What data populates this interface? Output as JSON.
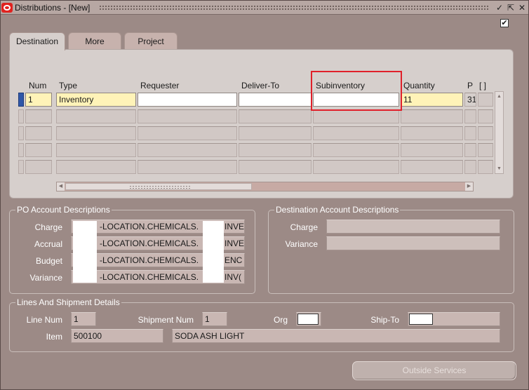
{
  "window": {
    "title": "Distributions - [New]",
    "check_mark": "✔",
    "minimize_glyph": "✓",
    "maximize_glyph": "⇱",
    "close_glyph": "✕"
  },
  "tabs": [
    {
      "label": "Destination",
      "active": true
    },
    {
      "label": "More",
      "active": false
    },
    {
      "label": "Project",
      "active": false
    }
  ],
  "grid": {
    "headers": {
      "num": "Num",
      "type": "Type",
      "requester": "Requester",
      "deliver_to": "Deliver-To",
      "subinventory": "Subinventory",
      "quantity": "Quantity",
      "p": "P",
      "bracket": "[ ]"
    },
    "rows": [
      {
        "num": "1",
        "type": "Inventory",
        "requester": "",
        "deliver_to": "",
        "subinventory": "",
        "quantity": "11",
        "p": "31"
      }
    ]
  },
  "po_account": {
    "title": "PO Account Descriptions",
    "rows": [
      {
        "label": "Charge",
        "value": "-LOCATION.CHEMICALS.",
        "suffix": "INVE"
      },
      {
        "label": "Accrual",
        "value": "-LOCATION.CHEMICALS.",
        "suffix": "INVE"
      },
      {
        "label": "Budget",
        "value": "-LOCATION.CHEMICALS.",
        "suffix": "ENC"
      },
      {
        "label": "Variance",
        "value": "-LOCATION.CHEMICALS.",
        "suffix": "INV("
      }
    ]
  },
  "dest_account": {
    "title": "Destination Account Descriptions",
    "charge_label": "Charge",
    "variance_label": "Variance",
    "charge_value": "",
    "variance_value": ""
  },
  "lines": {
    "title": "Lines And Shipment Details",
    "line_num_label": "Line Num",
    "line_num": "1",
    "shipment_num_label": "Shipment Num",
    "shipment_num": "1",
    "org_label": "Org",
    "ship_to_label": "Ship-To",
    "item_label": "Item",
    "item": "500100",
    "item_desc": "SODA ASH LIGHT"
  },
  "buttons": {
    "outside_services": "Outside Services"
  },
  "colors": {
    "highlight": "#e0202a",
    "required_field": "#fff3b8",
    "current_record": "#2f57a8"
  }
}
